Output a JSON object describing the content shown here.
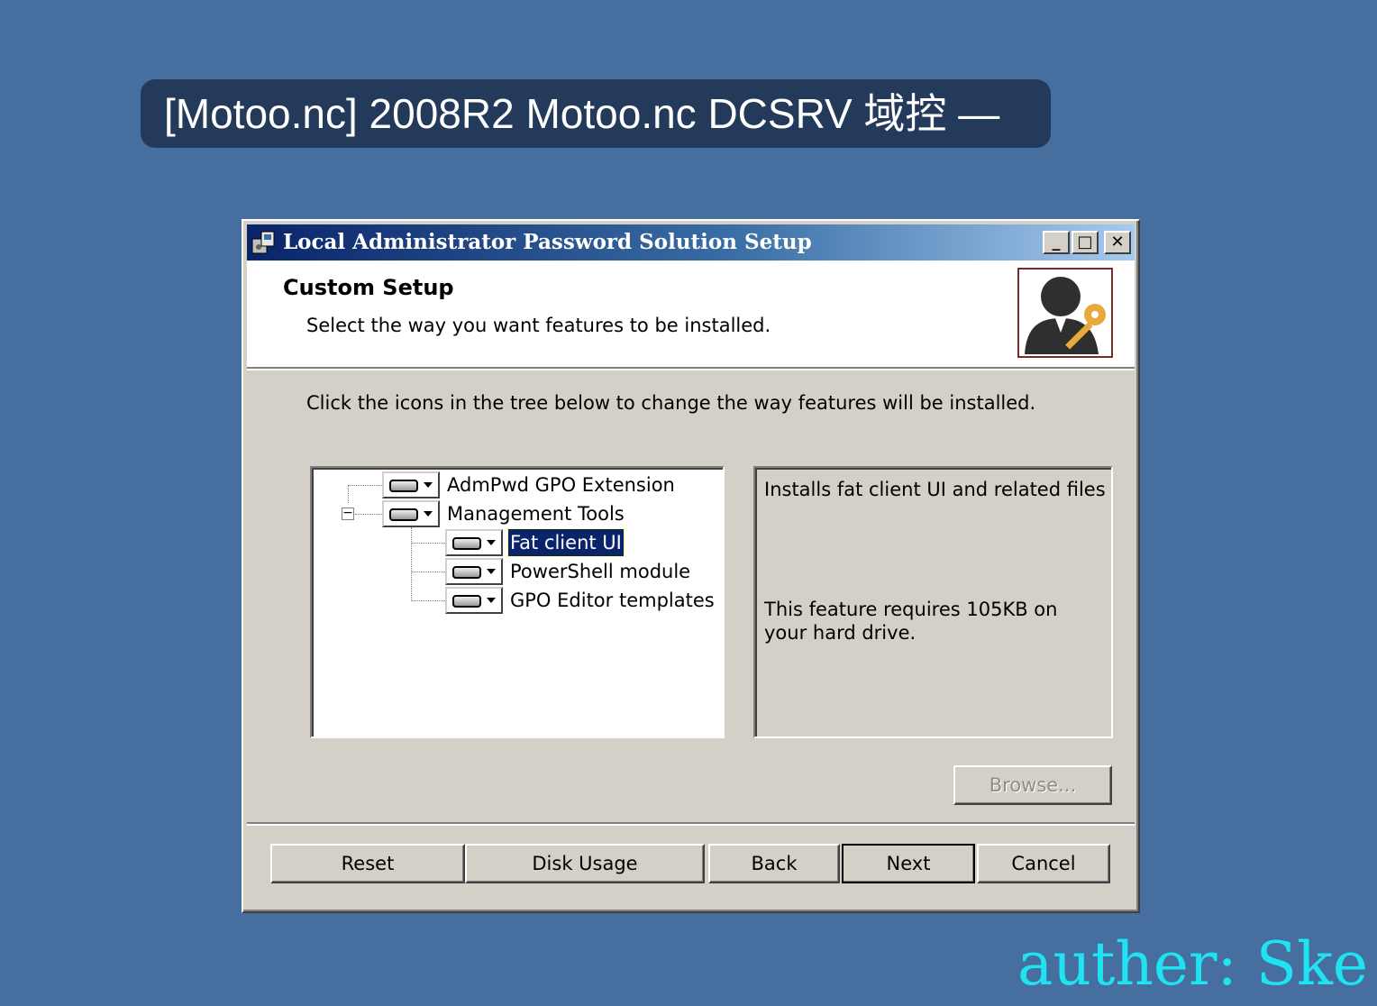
{
  "banner": {
    "text": "[Motoo.nc] 2008R2 Motoo.nc DCSRV 域控 —"
  },
  "window": {
    "title": "Local Administrator Password Solution Setup",
    "controls": {
      "minimize": "_",
      "maximize": "□",
      "close": "✕"
    }
  },
  "header": {
    "title": "Custom Setup",
    "subtitle": "Select the way you want features to be installed.",
    "logo_icon": "admin-key-icon"
  },
  "instruction": "Click the icons in the tree below to change the way features will be installed.",
  "tree": {
    "items": [
      {
        "label": "AdmPwd GPO Extension",
        "level": 0
      },
      {
        "label": "Management Tools",
        "level": 0,
        "expanded": true,
        "expander": "−"
      },
      {
        "label": "Fat client UI",
        "level": 1,
        "selected": true
      },
      {
        "label": "PowerShell module",
        "level": 1
      },
      {
        "label": "GPO Editor templates",
        "level": 1
      }
    ]
  },
  "description": {
    "line1": "Installs fat client UI and related files",
    "line2": "This feature requires 105KB on your hard drive."
  },
  "buttons": {
    "browse": "Browse...",
    "reset": "Reset",
    "disk_usage": "Disk Usage",
    "back": "Back",
    "next": "Next",
    "cancel": "Cancel"
  },
  "watermark": "auther: Ske",
  "colors": {
    "desktop": "#466fa0",
    "titlebar_start": "#0a246a",
    "titlebar_end": "#a6caf0",
    "dialog_face": "#d4d0c8",
    "watermark": "#1fe3f0"
  }
}
